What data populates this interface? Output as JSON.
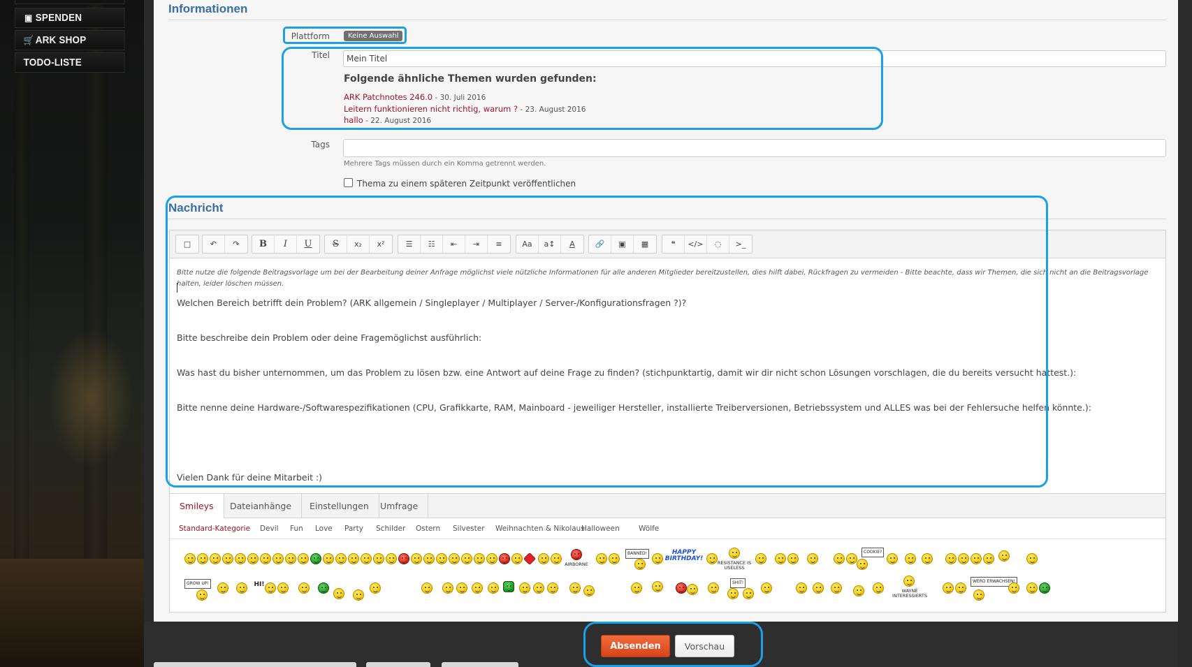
{
  "sidebar": {
    "items": [
      {
        "label": "SPENDEN",
        "icon": "money-icon"
      },
      {
        "label": "ARK SHOP",
        "icon": "cart-icon"
      },
      {
        "label": "TODO-LISTE",
        "icon": ""
      }
    ]
  },
  "informationen": {
    "title": "Informationen",
    "platform_label": "Plattform",
    "platform_value": "Keine Auswahl",
    "title_label": "Titel",
    "title_value": "Mein Titel",
    "similar_heading": "Folgende ähnliche Themen wurden gefunden:",
    "similar": [
      {
        "title": "ARK Patchnotes 246.0",
        "date": " - 30. Juli 2016"
      },
      {
        "title": "Leitern funktionieren nicht richtig, warum ?",
        "date": " - 23. August 2016"
      },
      {
        "title": "hallo",
        "date": " - 22. August 2016"
      }
    ],
    "tags_label": "Tags",
    "tags_hint": "Mehrere Tags müssen durch ein Komma getrennt werden.",
    "later_label": "Thema zu einem späteren Zeitpunkt veröffentlichen"
  },
  "nachricht": {
    "title": "Nachricht",
    "intro": "Bitte nutze die folgende Beitragsvorlage um bei der Bearbeitung deiner Anfrage möglichst viele nützliche Informationen für alle anderen Mitglieder bereitzustellen, dies hilft dabei, Rückfragen zu vermeiden - Bitte beachte, dass wir Themen, die sich nicht an die Beitragsvorlage halten, leider löschen müssen.",
    "lines": [
      "Welchen Bereich betrifft dein Problem? (ARK allgemein / Singleplayer / Multiplayer / Server-/Konfigurationsfragen ?)?",
      "Bitte beschreibe dein Problem oder deine Fragemöglichst ausführlich:",
      "Was hast du bisher unternommen, um das Problem zu lösen bzw. eine Antwort auf deine Frage zu finden? (stichpunktartig, damit wir dir nicht schon Lösungen vorschlagen, die du bereits versucht hattest.):",
      "Bitte nenne deine Hardware-/Softwarespezifikationen (CPU, Grafikkarte, RAM, Mainboard - jeweiliger Hersteller, installierte Treiberversionen, Betriebssystem und ALLES was bei der Fehlersuche helfen könnte.):",
      "Vielen Dank für deine Mitarbeit :)"
    ],
    "toolbar": [
      [
        "□"
      ],
      [
        "↶",
        "↷"
      ],
      [
        "B",
        "I",
        "U"
      ],
      [
        "S",
        "x₂",
        "x²"
      ],
      [
        "☰",
        "☷",
        "⇤",
        "⇥",
        "≡"
      ],
      [
        "Aa",
        "a↕",
        "A"
      ],
      [
        "🔗",
        "▣",
        "▦"
      ],
      [
        "❝",
        "</>",
        "◌",
        ">_"
      ]
    ],
    "tabs": [
      "Smileys",
      "Dateianhänge",
      "Einstellungen",
      "Umfrage"
    ],
    "subcategories": [
      "Standard-Kategorie",
      "Devil",
      "Fun",
      "Love",
      "Party",
      "Schilder",
      "Ostern",
      "Silvester",
      "Weihnachten & Nikolaus",
      "Halloween",
      "Wölfe"
    ],
    "smiley_texts": {
      "airborne": "AIRBORNE",
      "banned": "BANNED!",
      "birthday": "HAPPY BIRTHDAY!",
      "resistance": "RESISTANCE IS USELESS",
      "cookie": "COOKIE?",
      "growup": "GROW UP!",
      "hi": "HI!",
      "shit": "SHIT!",
      "wayne": "WAYNE INTERESSIERTS",
      "erwachsen": "WERD ERWACHSEN!"
    }
  },
  "actions": {
    "submit": "Absenden",
    "preview": "Vorschau"
  }
}
